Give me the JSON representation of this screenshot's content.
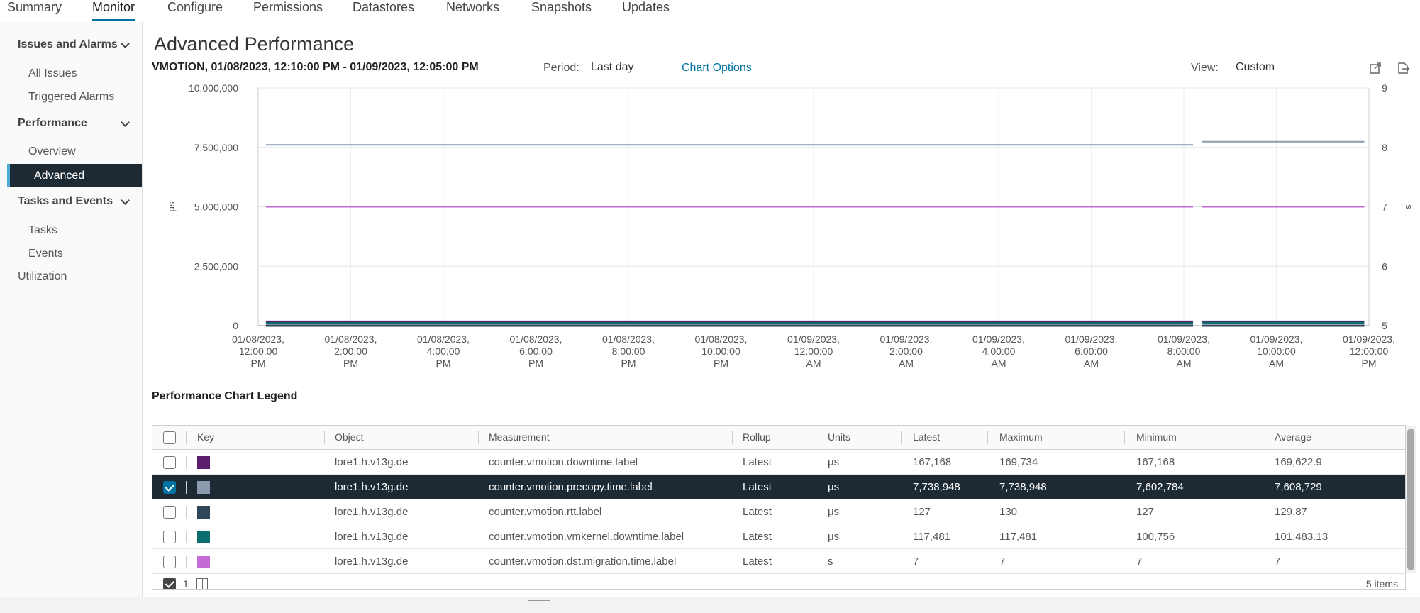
{
  "tabs": [
    {
      "label": "Summary"
    },
    {
      "label": "Monitor",
      "active": true
    },
    {
      "label": "Configure"
    },
    {
      "label": "Permissions"
    },
    {
      "label": "Datastores"
    },
    {
      "label": "Networks"
    },
    {
      "label": "Snapshots"
    },
    {
      "label": "Updates"
    }
  ],
  "sidebar": {
    "issues_group": "Issues and Alarms",
    "issues_items": [
      "All Issues",
      "Triggered Alarms"
    ],
    "performance_group": "Performance",
    "performance_items": [
      "Overview",
      "Advanced"
    ],
    "tasks_group": "Tasks and Events",
    "tasks_items": [
      "Tasks",
      "Events"
    ],
    "utilization": "Utilization"
  },
  "header": {
    "title": "Advanced Performance",
    "vm_range": "VMOTION, 01/08/2023, 12:10:00 PM - 01/09/2023, 12:05:00 PM",
    "period_label": "Period:",
    "period_value": "Last day",
    "chart_options": "Chart Options",
    "view_label": "View:",
    "view_value": "Custom"
  },
  "chart_data": {
    "type": "line",
    "x": [
      "01/08/2023, 12:00:00 PM",
      "01/08/2023, 2:00:00 PM",
      "01/08/2023, 4:00:00 PM",
      "01/08/2023, 6:00:00 PM",
      "01/08/2023, 8:00:00 PM",
      "01/08/2023, 10:00:00 PM",
      "01/09/2023, 12:00:00 AM",
      "01/09/2023, 2:00:00 AM",
      "01/09/2023, 4:00:00 AM",
      "01/09/2023, 6:00:00 AM",
      "01/09/2023, 8:00:00 AM",
      "01/09/2023, 10:00:00 AM",
      "01/09/2023, 12:00:00 PM"
    ],
    "x_tick_lines": [
      [
        "01/08/2023,",
        "12:00:00",
        "PM"
      ],
      [
        "01/08/2023,",
        "2:00:00",
        "PM"
      ],
      [
        "01/08/2023,",
        "4:00:00",
        "PM"
      ],
      [
        "01/08/2023,",
        "6:00:00",
        "PM"
      ],
      [
        "01/08/2023,",
        "8:00:00",
        "PM"
      ],
      [
        "01/08/2023,",
        "10:00:00",
        "PM"
      ],
      [
        "01/09/2023,",
        "12:00:00",
        "AM"
      ],
      [
        "01/09/2023,",
        "2:00:00",
        "AM"
      ],
      [
        "01/09/2023,",
        "4:00:00",
        "AM"
      ],
      [
        "01/09/2023,",
        "6:00:00",
        "AM"
      ],
      [
        "01/09/2023,",
        "8:00:00",
        "AM"
      ],
      [
        "01/09/2023,",
        "10:00:00",
        "AM"
      ],
      [
        "01/09/2023,",
        "12:00:00",
        "PM"
      ]
    ],
    "ylabel_left": "μs",
    "ylabel_right": "s",
    "ylim_left": [
      0,
      10000000
    ],
    "ylim_right": [
      5,
      9
    ],
    "y_ticks_left": [
      "10,000,000",
      "7,500,000",
      "5,000,000",
      "2,500,000",
      "0"
    ],
    "y_ticks_right": [
      "9",
      "8",
      "7",
      "6",
      "5"
    ],
    "x_start_hours": 0.167,
    "x_end_hours": 23.9,
    "gap_hours": [
      20.2,
      20.4
    ],
    "series": [
      {
        "color": "#5b1e6e",
        "axis": "left",
        "start": 169734,
        "end": 167168
      },
      {
        "color": "#8a9bb0",
        "axis": "left",
        "start": 7602784,
        "end": 7738948
      },
      {
        "color": "#2f4558",
        "axis": "left",
        "start": 127,
        "end": 127
      },
      {
        "color": "#0b6e6e",
        "axis": "left",
        "start": 100756,
        "end": 117481
      },
      {
        "color": "#c36bd6",
        "axis": "right",
        "start": 7,
        "end": 7
      }
    ]
  },
  "legend": {
    "title": "Performance Chart Legend",
    "columns": [
      "Key",
      "Object",
      "Measurement",
      "Rollup",
      "Units",
      "Latest",
      "Maximum",
      "Minimum",
      "Average"
    ],
    "rows": [
      {
        "color": "#5b1e6e",
        "object": "lore1.h.v13g.de",
        "measurement": "counter.vmotion.downtime.label",
        "rollup": "Latest",
        "units": "μs",
        "latest": "167,168",
        "maximum": "169,734",
        "minimum": "167,168",
        "average": "169,622.9",
        "selected": false
      },
      {
        "color": "#8a9bb0",
        "object": "lore1.h.v13g.de",
        "measurement": "counter.vmotion.precopy.time.label",
        "rollup": "Latest",
        "units": "μs",
        "latest": "7,738,948",
        "maximum": "7,738,948",
        "minimum": "7,602,784",
        "average": "7,608,729",
        "selected": true
      },
      {
        "color": "#2f4558",
        "object": "lore1.h.v13g.de",
        "measurement": "counter.vmotion.rtt.label",
        "rollup": "Latest",
        "units": "μs",
        "latest": "127",
        "maximum": "130",
        "minimum": "127",
        "average": "129.87",
        "selected": false
      },
      {
        "color": "#0b6e6e",
        "object": "lore1.h.v13g.de",
        "measurement": "counter.vmotion.vmkernel.downtime.label",
        "rollup": "Latest",
        "units": "μs",
        "latest": "117,481",
        "maximum": "117,481",
        "minimum": "100,756",
        "average": "101,483.13",
        "selected": false
      },
      {
        "color": "#c36bd6",
        "object": "lore1.h.v13g.de",
        "measurement": "counter.vmotion.dst.migration.time.label",
        "rollup": "Latest",
        "units": "s",
        "latest": "7",
        "maximum": "7",
        "minimum": "7",
        "average": "7",
        "selected": false
      }
    ],
    "footer_selected_count": "1",
    "items_count": "5 items"
  }
}
